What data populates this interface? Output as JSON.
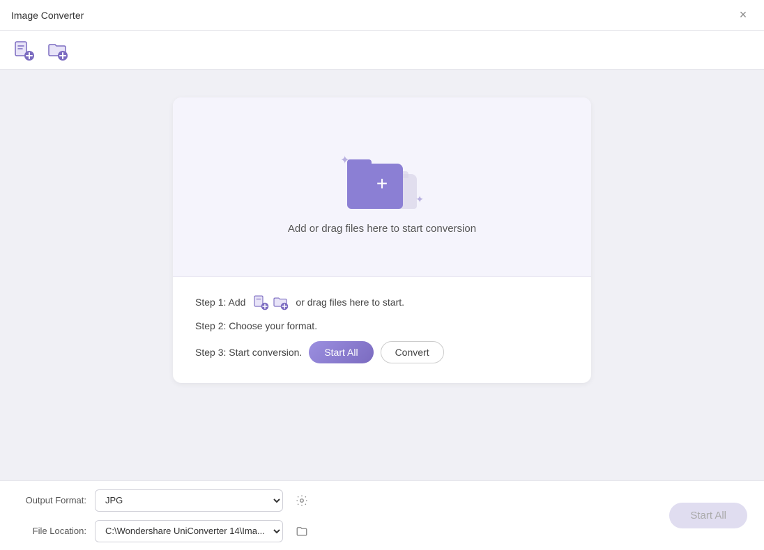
{
  "titleBar": {
    "title": "Image Converter",
    "closeLabel": "×"
  },
  "toolbar": {
    "addFileIcon": "add-file-icon",
    "addFolderIcon": "add-folder-icon"
  },
  "dropArea": {
    "label": "Add or drag files here to start conversion"
  },
  "steps": {
    "step1": "Step 1: Add",
    "step1suffix": "or drag files here to start.",
    "step2": "Step 2: Choose your format.",
    "step3": "Step 3: Start conversion.",
    "startAllLabel": "Start All",
    "convertLabel": "Convert"
  },
  "bottomBar": {
    "outputFormatLabel": "Output Format:",
    "outputFormatValue": "JPG",
    "fileLocationLabel": "File Location:",
    "fileLocationValue": "C:\\Wondershare UniConverter 14\\Ima...",
    "startAllLabel": "Start All",
    "settingsIconTitle": "settings",
    "folderIconTitle": "open folder"
  }
}
